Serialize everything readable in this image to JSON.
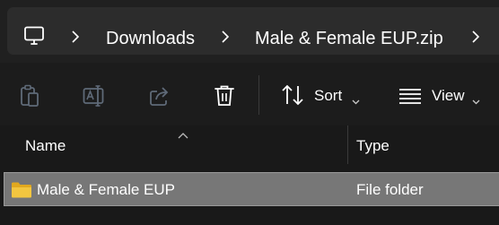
{
  "address_bar": {
    "root_icon": "computer-monitor-icon",
    "crumbs": [
      "Downloads",
      "Male & Female EUP.zip"
    ]
  },
  "toolbar": {
    "paste_icon": "paste-icon",
    "rename_icon": "rename-icon",
    "share_icon": "share-icon",
    "delete_icon": "trash-icon",
    "sort_label": "Sort",
    "view_label": "View"
  },
  "columns": {
    "name": "Name",
    "type": "Type"
  },
  "rows": [
    {
      "name": "Male & Female EUP",
      "type": "File folder",
      "icon": "folder-icon"
    }
  ],
  "colors": {
    "background": "#191919",
    "address_bar": "#2c2c2c",
    "selected_row": "#777777",
    "folder": "#f3c640",
    "disabled_icon": "#5f6a78"
  }
}
